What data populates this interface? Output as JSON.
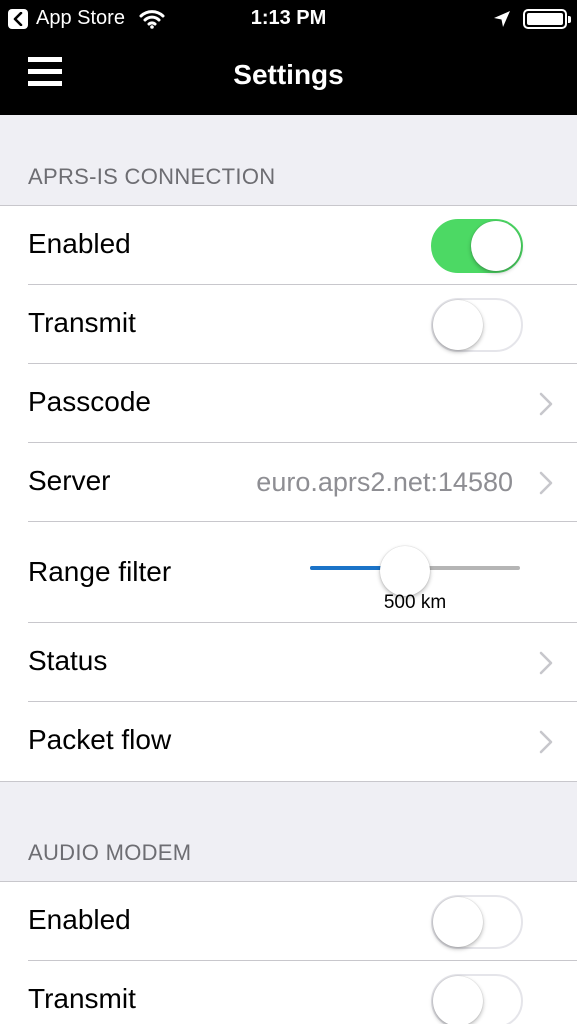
{
  "status_bar": {
    "back_app": "App Store",
    "time": "1:13 PM"
  },
  "nav": {
    "title": "Settings"
  },
  "sections": [
    {
      "header": "APRS-IS CONNECTION",
      "rows": [
        {
          "label": "Enabled",
          "switch_on": true
        },
        {
          "label": "Transmit",
          "switch_on": false
        },
        {
          "label": "Passcode"
        },
        {
          "label": "Server",
          "detail": "euro.aprs2.net:14580"
        },
        {
          "label": "Range filter",
          "slider_value_text": "500 km",
          "slider_fraction": 0.45
        },
        {
          "label": "Status"
        },
        {
          "label": "Packet flow"
        }
      ]
    },
    {
      "header": "AUDIO MODEM",
      "rows": [
        {
          "label": "Enabled",
          "switch_on": false
        },
        {
          "label": "Transmit",
          "switch_on": false
        }
      ]
    }
  ],
  "colors": {
    "switch_on": "#4cd964",
    "slider_fill": "#1a73c8",
    "section_header": "#6d6d72",
    "detail_text": "#8e8e93",
    "background": "#efeff4"
  },
  "icons": [
    "back-arrow-icon",
    "wifi-icon",
    "location-arrow-icon",
    "battery-icon",
    "hamburger-menu-icon",
    "chevron-right-icon"
  ]
}
